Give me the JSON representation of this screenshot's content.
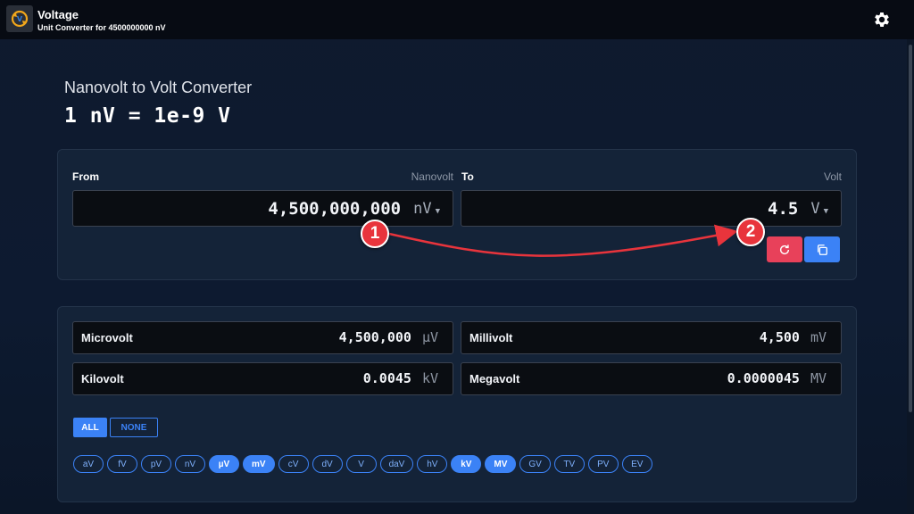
{
  "header": {
    "title": "Voltage",
    "subtitle": "Unit Converter for 4500000000 nV",
    "logo_icon": "voltage-converter-logo",
    "settings_icon": "gear-icon"
  },
  "converter": {
    "title": "Nanovolt to Volt Converter",
    "formula": "1 nV = 1e-9 V",
    "from": {
      "label": "From",
      "unit_name": "Nanovolt",
      "value": "4,500,000,000",
      "unit": "nV"
    },
    "to": {
      "label": "To",
      "unit_name": "Volt",
      "value": "4.5",
      "unit": "V"
    },
    "refresh_icon": "refresh-icon",
    "copy_icon": "copy-icon"
  },
  "results": [
    {
      "name": "Microvolt",
      "value": "4,500,000",
      "unit": "µV"
    },
    {
      "name": "Millivolt",
      "value": "4,500",
      "unit": "mV"
    },
    {
      "name": "Kilovolt",
      "value": "0.0045",
      "unit": "kV"
    },
    {
      "name": "Megavolt",
      "value": "0.0000045",
      "unit": "MV"
    }
  ],
  "toggles": {
    "all": "ALL",
    "none": "NONE"
  },
  "units": [
    {
      "label": "aV",
      "active": false
    },
    {
      "label": "fV",
      "active": false
    },
    {
      "label": "pV",
      "active": false
    },
    {
      "label": "nV",
      "active": false
    },
    {
      "label": "µV",
      "active": true
    },
    {
      "label": "mV",
      "active": true
    },
    {
      "label": "cV",
      "active": false
    },
    {
      "label": "dV",
      "active": false
    },
    {
      "label": "V",
      "active": false
    },
    {
      "label": "daV",
      "active": false
    },
    {
      "label": "hV",
      "active": false
    },
    {
      "label": "kV",
      "active": true
    },
    {
      "label": "MV",
      "active": true
    },
    {
      "label": "GV",
      "active": false
    },
    {
      "label": "TV",
      "active": false
    },
    {
      "label": "PV",
      "active": false
    },
    {
      "label": "EV",
      "active": false
    }
  ],
  "annotations": {
    "marker_1": "1",
    "marker_2": "2"
  },
  "colors": {
    "accent": "#3b82f6",
    "danger": "#e8415a",
    "marker": "#e8343c"
  }
}
